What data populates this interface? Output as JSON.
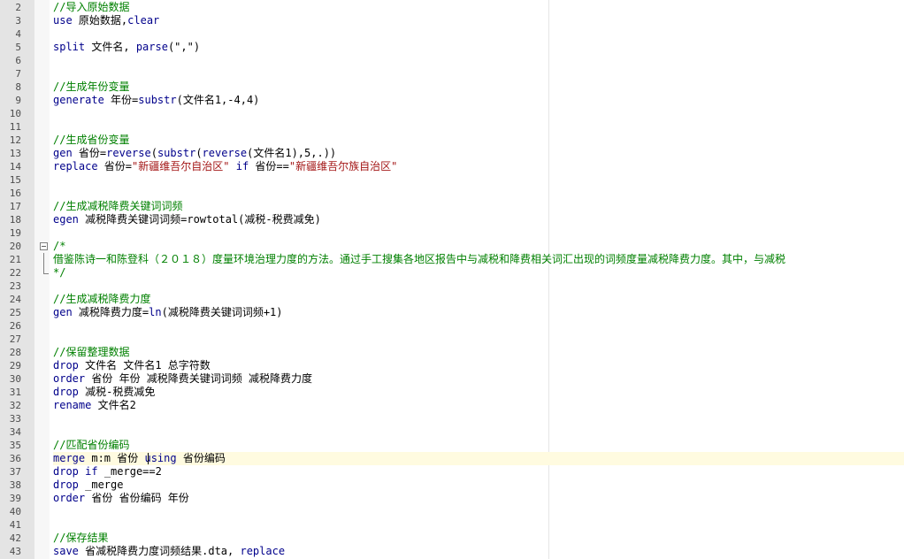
{
  "editor": {
    "current_line": 36,
    "lines": [
      {
        "n": "2",
        "tokens": [
          {
            "t": "//导入原始数据",
            "c": "c"
          }
        ]
      },
      {
        "n": "3",
        "tokens": [
          {
            "t": "use",
            "c": "k"
          },
          {
            "t": " 原始数据,",
            "c": "x"
          },
          {
            "t": "clear",
            "c": "k"
          }
        ]
      },
      {
        "n": "4",
        "tokens": []
      },
      {
        "n": "5",
        "tokens": [
          {
            "t": "split",
            "c": "k"
          },
          {
            "t": " 文件名, ",
            "c": "x"
          },
          {
            "t": "parse",
            "c": "k"
          },
          {
            "t": "(\",\")",
            "c": "x"
          }
        ]
      },
      {
        "n": "6",
        "tokens": []
      },
      {
        "n": "7",
        "tokens": []
      },
      {
        "n": "8",
        "tokens": [
          {
            "t": "//生成年份变量",
            "c": "c"
          }
        ]
      },
      {
        "n": "9",
        "tokens": [
          {
            "t": "generate",
            "c": "k"
          },
          {
            "t": " 年份=",
            "c": "x"
          },
          {
            "t": "substr",
            "c": "k"
          },
          {
            "t": "(文件名1,-4,4)",
            "c": "x"
          }
        ]
      },
      {
        "n": "10",
        "tokens": []
      },
      {
        "n": "11",
        "tokens": []
      },
      {
        "n": "12",
        "tokens": [
          {
            "t": "//生成省份变量",
            "c": "c"
          }
        ]
      },
      {
        "n": "13",
        "tokens": [
          {
            "t": "gen",
            "c": "k"
          },
          {
            "t": " 省份=",
            "c": "x"
          },
          {
            "t": "reverse",
            "c": "k"
          },
          {
            "t": "(",
            "c": "x"
          },
          {
            "t": "substr",
            "c": "k"
          },
          {
            "t": "(",
            "c": "x"
          },
          {
            "t": "reverse",
            "c": "k"
          },
          {
            "t": "(文件名1),5,.))",
            "c": "x"
          }
        ]
      },
      {
        "n": "14",
        "tokens": [
          {
            "t": "replace",
            "c": "k"
          },
          {
            "t": " 省份=",
            "c": "x"
          },
          {
            "t": "\"新疆维吾尔自治区\"",
            "c": "s"
          },
          {
            "t": " ",
            "c": "x"
          },
          {
            "t": "if",
            "c": "k"
          },
          {
            "t": " 省份==",
            "c": "x"
          },
          {
            "t": "\"新疆维吾尔族自治区\"",
            "c": "s"
          }
        ]
      },
      {
        "n": "15",
        "tokens": []
      },
      {
        "n": "16",
        "tokens": []
      },
      {
        "n": "17",
        "tokens": [
          {
            "t": "//生成减税降费关键词词频",
            "c": "c"
          }
        ]
      },
      {
        "n": "18",
        "tokens": [
          {
            "t": "egen",
            "c": "k"
          },
          {
            "t": " 减税降费关键词词频=rowtotal(减税-税费减免)",
            "c": "x"
          }
        ]
      },
      {
        "n": "19",
        "tokens": []
      },
      {
        "n": "20",
        "fold": "start",
        "tokens": [
          {
            "t": "/*",
            "c": "c"
          }
        ]
      },
      {
        "n": "21",
        "fold": "mid",
        "tokens": [
          {
            "t": "借鉴陈诗一和陈登科（２０１８）度量环境治理力度的方法。通过手工搜集各地区报告中与减税和降费相关词汇出现的词频度量减税降费力度。其中，与减税",
            "c": "c"
          }
        ]
      },
      {
        "n": "22",
        "fold": "end",
        "tokens": [
          {
            "t": "*/",
            "c": "c"
          }
        ]
      },
      {
        "n": "23",
        "tokens": []
      },
      {
        "n": "24",
        "tokens": [
          {
            "t": "//生成减税降费力度",
            "c": "c"
          }
        ]
      },
      {
        "n": "25",
        "tokens": [
          {
            "t": "gen",
            "c": "k"
          },
          {
            "t": " 减税降费力度=",
            "c": "x"
          },
          {
            "t": "ln",
            "c": "k"
          },
          {
            "t": "(减税降费关键词词频+1)",
            "c": "x"
          }
        ]
      },
      {
        "n": "26",
        "tokens": []
      },
      {
        "n": "27",
        "tokens": []
      },
      {
        "n": "28",
        "tokens": [
          {
            "t": "//保留整理数据",
            "c": "c"
          }
        ]
      },
      {
        "n": "29",
        "tokens": [
          {
            "t": "drop",
            "c": "k"
          },
          {
            "t": " 文件名 文件名1 总字符数",
            "c": "x"
          }
        ]
      },
      {
        "n": "30",
        "tokens": [
          {
            "t": "order",
            "c": "k"
          },
          {
            "t": " 省份 年份 减税降费关键词词频 减税降费力度",
            "c": "x"
          }
        ]
      },
      {
        "n": "31",
        "tokens": [
          {
            "t": "drop",
            "c": "k"
          },
          {
            "t": " 减税-税费减免",
            "c": "x"
          }
        ]
      },
      {
        "n": "32",
        "tokens": [
          {
            "t": "rename",
            "c": "k"
          },
          {
            "t": " 文件名2",
            "c": "x"
          }
        ]
      },
      {
        "n": "33",
        "tokens": []
      },
      {
        "n": "34",
        "tokens": []
      },
      {
        "n": "35",
        "tokens": [
          {
            "t": "//匹配省份编码",
            "c": "c"
          }
        ]
      },
      {
        "n": "36",
        "tokens": [
          {
            "t": "merge",
            "c": "k"
          },
          {
            "t": " m:m 省份 ",
            "c": "x"
          },
          {
            "t": "using",
            "c": "k"
          },
          {
            "t": " 省份编码",
            "c": "x"
          }
        ]
      },
      {
        "n": "37",
        "tokens": [
          {
            "t": "drop",
            "c": "k"
          },
          {
            "t": " ",
            "c": "x"
          },
          {
            "t": "if",
            "c": "k"
          },
          {
            "t": " _merge==2",
            "c": "x"
          }
        ]
      },
      {
        "n": "38",
        "tokens": [
          {
            "t": "drop",
            "c": "k"
          },
          {
            "t": " _merge",
            "c": "x"
          }
        ]
      },
      {
        "n": "39",
        "tokens": [
          {
            "t": "order",
            "c": "k"
          },
          {
            "t": " 省份 省份编码 年份",
            "c": "x"
          }
        ]
      },
      {
        "n": "40",
        "tokens": []
      },
      {
        "n": "41",
        "tokens": []
      },
      {
        "n": "42",
        "tokens": [
          {
            "t": "//保存结果",
            "c": "c"
          }
        ]
      },
      {
        "n": "43",
        "tokens": [
          {
            "t": "save",
            "c": "k"
          },
          {
            "t": " 省减税降费力度词频结果.dta, ",
            "c": "x"
          },
          {
            "t": "replace",
            "c": "k"
          }
        ]
      }
    ]
  }
}
